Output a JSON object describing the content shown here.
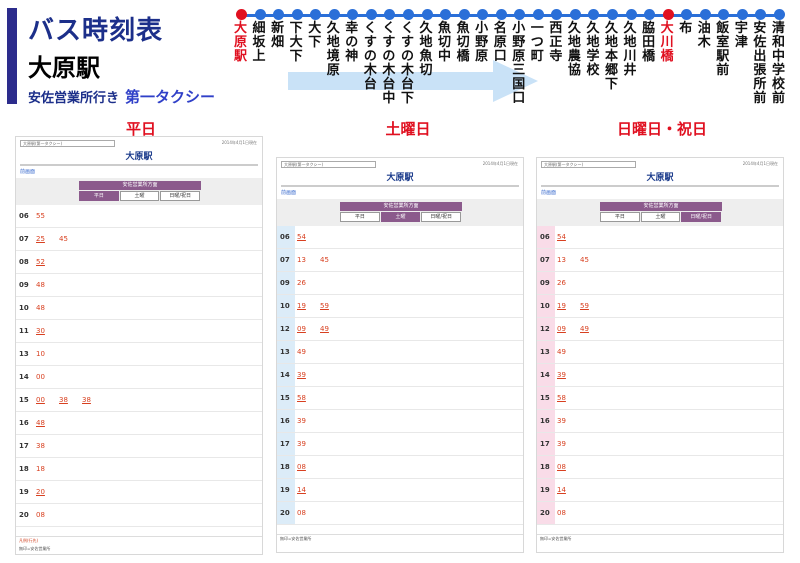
{
  "header": {
    "title": "バス時刻表",
    "station": "大原駅",
    "route": "安佐営業所行き",
    "operator": "第一タクシー"
  },
  "stops": [
    {
      "name": "大原駅",
      "current": true
    },
    {
      "name": "細坂上",
      "current": false
    },
    {
      "name": "新畑",
      "current": false
    },
    {
      "name": "下大下",
      "current": false
    },
    {
      "name": "大下",
      "current": false
    },
    {
      "name": "久地境原",
      "current": false
    },
    {
      "name": "幸の神",
      "current": false
    },
    {
      "name": "くすの木台",
      "current": false
    },
    {
      "name": "くすの木台中",
      "current": false
    },
    {
      "name": "くすの木台下",
      "current": false
    },
    {
      "name": "久地魚切",
      "current": false
    },
    {
      "name": "魚切中",
      "current": false
    },
    {
      "name": "魚切橋",
      "current": false
    },
    {
      "name": "小野原",
      "current": false
    },
    {
      "name": "名原口",
      "current": false
    },
    {
      "name": "小野原三国口",
      "current": false
    },
    {
      "name": "一つ町",
      "current": false
    },
    {
      "name": "西正寺",
      "current": false
    },
    {
      "name": "久地農協",
      "current": false
    },
    {
      "name": "久地学校",
      "current": false
    },
    {
      "name": "久地本郷下",
      "current": false
    },
    {
      "name": "久地川井",
      "current": false
    },
    {
      "name": "脇田橋",
      "current": false
    },
    {
      "name": "大川橋",
      "current": true
    },
    {
      "name": "布",
      "current": false
    },
    {
      "name": "油木",
      "current": false
    },
    {
      "name": "飯室駅前",
      "current": false
    },
    {
      "name": "宇津",
      "current": false
    },
    {
      "name": "安佐出張所前",
      "current": false
    },
    {
      "name": "清和中学校前",
      "current": false
    }
  ],
  "columns": [
    "平日",
    "土曜日",
    "日曜日・祝日"
  ],
  "panel_common": {
    "select": "大原駅(第一タクシー)",
    "station": "大原駅",
    "back": "前画面",
    "direction": "安佐営業所方面",
    "tabs": [
      "平日",
      "土曜",
      "日曜/祝日"
    ]
  },
  "panels": [
    {
      "date": "2014年4月1日現在",
      "active_tab": 0,
      "rows": [
        {
          "hour": "06",
          "mins": [
            {
              "m": "55",
              "u": false
            }
          ]
        },
        {
          "hour": "07",
          "mins": [
            {
              "m": "25",
              "u": true
            },
            {
              "m": "45",
              "u": false
            }
          ]
        },
        {
          "hour": "08",
          "mins": [
            {
              "m": "52",
              "u": true
            }
          ]
        },
        {
          "hour": "09",
          "mins": [
            {
              "m": "48",
              "u": false
            }
          ]
        },
        {
          "hour": "10",
          "mins": [
            {
              "m": "48",
              "u": false
            }
          ]
        },
        {
          "hour": "11",
          "mins": [
            {
              "m": "30",
              "u": true
            }
          ]
        },
        {
          "hour": "13",
          "mins": [
            {
              "m": "10",
              "u": false
            }
          ]
        },
        {
          "hour": "14",
          "mins": [
            {
              "m": "00",
              "u": false
            }
          ]
        },
        {
          "hour": "15",
          "mins": [
            {
              "m": "00",
              "u": true
            },
            {
              "m": "38",
              "u": true
            },
            {
              "m": "38",
              "u": true
            }
          ]
        },
        {
          "hour": "16",
          "mins": [
            {
              "m": "48",
              "u": true
            }
          ]
        },
        {
          "hour": "17",
          "mins": [
            {
              "m": "38",
              "u": false
            }
          ]
        },
        {
          "hour": "18",
          "mins": [
            {
              "m": "18",
              "u": false
            }
          ]
        },
        {
          "hour": "19",
          "mins": [
            {
              "m": "20",
              "u": true
            }
          ]
        },
        {
          "hour": "20",
          "mins": [
            {
              "m": "08",
              "u": false
            }
          ]
        }
      ],
      "legend": "凡例(行先)",
      "footnote": "無印=安佐営業所"
    },
    {
      "date": "2014年4月1日現在",
      "active_tab": 1,
      "rows": [
        {
          "hour": "06",
          "mins": [
            {
              "m": "54",
              "u": true
            }
          ]
        },
        {
          "hour": "07",
          "mins": [
            {
              "m": "13",
              "u": false
            },
            {
              "m": "45",
              "u": false
            }
          ]
        },
        {
          "hour": "09",
          "mins": [
            {
              "m": "26",
              "u": false
            }
          ]
        },
        {
          "hour": "10",
          "mins": [
            {
              "m": "19",
              "u": true
            },
            {
              "m": "59",
              "u": true
            }
          ]
        },
        {
          "hour": "12",
          "mins": [
            {
              "m": "09",
              "u": true
            },
            {
              "m": "49",
              "u": true
            }
          ]
        },
        {
          "hour": "13",
          "mins": [
            {
              "m": "49",
              "u": false
            }
          ]
        },
        {
          "hour": "14",
          "mins": [
            {
              "m": "39",
              "u": true
            }
          ]
        },
        {
          "hour": "15",
          "mins": [
            {
              "m": "58",
              "u": true
            }
          ]
        },
        {
          "hour": "16",
          "mins": [
            {
              "m": "39",
              "u": false
            }
          ]
        },
        {
          "hour": "17",
          "mins": [
            {
              "m": "39",
              "u": false
            }
          ]
        },
        {
          "hour": "18",
          "mins": [
            {
              "m": "08",
              "u": true
            }
          ]
        },
        {
          "hour": "19",
          "mins": [
            {
              "m": "14",
              "u": true
            }
          ]
        },
        {
          "hour": "20",
          "mins": [
            {
              "m": "08",
              "u": false
            }
          ]
        }
      ],
      "legend": "",
      "footnote": "無印=安佐営業所"
    },
    {
      "date": "2014年4月1日現在",
      "active_tab": 2,
      "rows": [
        {
          "hour": "06",
          "mins": [
            {
              "m": "54",
              "u": true
            }
          ]
        },
        {
          "hour": "07",
          "mins": [
            {
              "m": "13",
              "u": false
            },
            {
              "m": "45",
              "u": false
            }
          ]
        },
        {
          "hour": "09",
          "mins": [
            {
              "m": "26",
              "u": false
            }
          ]
        },
        {
          "hour": "10",
          "mins": [
            {
              "m": "19",
              "u": true
            },
            {
              "m": "59",
              "u": true
            }
          ]
        },
        {
          "hour": "12",
          "mins": [
            {
              "m": "09",
              "u": true
            },
            {
              "m": "49",
              "u": true
            }
          ]
        },
        {
          "hour": "13",
          "mins": [
            {
              "m": "49",
              "u": false
            }
          ]
        },
        {
          "hour": "14",
          "mins": [
            {
              "m": "39",
              "u": true
            }
          ]
        },
        {
          "hour": "15",
          "mins": [
            {
              "m": "58",
              "u": true
            }
          ]
        },
        {
          "hour": "16",
          "mins": [
            {
              "m": "39",
              "u": false
            }
          ]
        },
        {
          "hour": "17",
          "mins": [
            {
              "m": "39",
              "u": false
            }
          ]
        },
        {
          "hour": "18",
          "mins": [
            {
              "m": "08",
              "u": true
            }
          ]
        },
        {
          "hour": "19",
          "mins": [
            {
              "m": "14",
              "u": true
            }
          ]
        },
        {
          "hour": "20",
          "mins": [
            {
              "m": "08",
              "u": false
            }
          ]
        }
      ],
      "legend": "",
      "footnote": "無印=安佐営業所"
    }
  ],
  "colors": {
    "accent": "#2c2c8c",
    "tab": "#8b5a8c",
    "minute": "#d84020",
    "line": "#2a6fd8",
    "stopHighlight": "#e01020",
    "heading": "#e01020"
  }
}
